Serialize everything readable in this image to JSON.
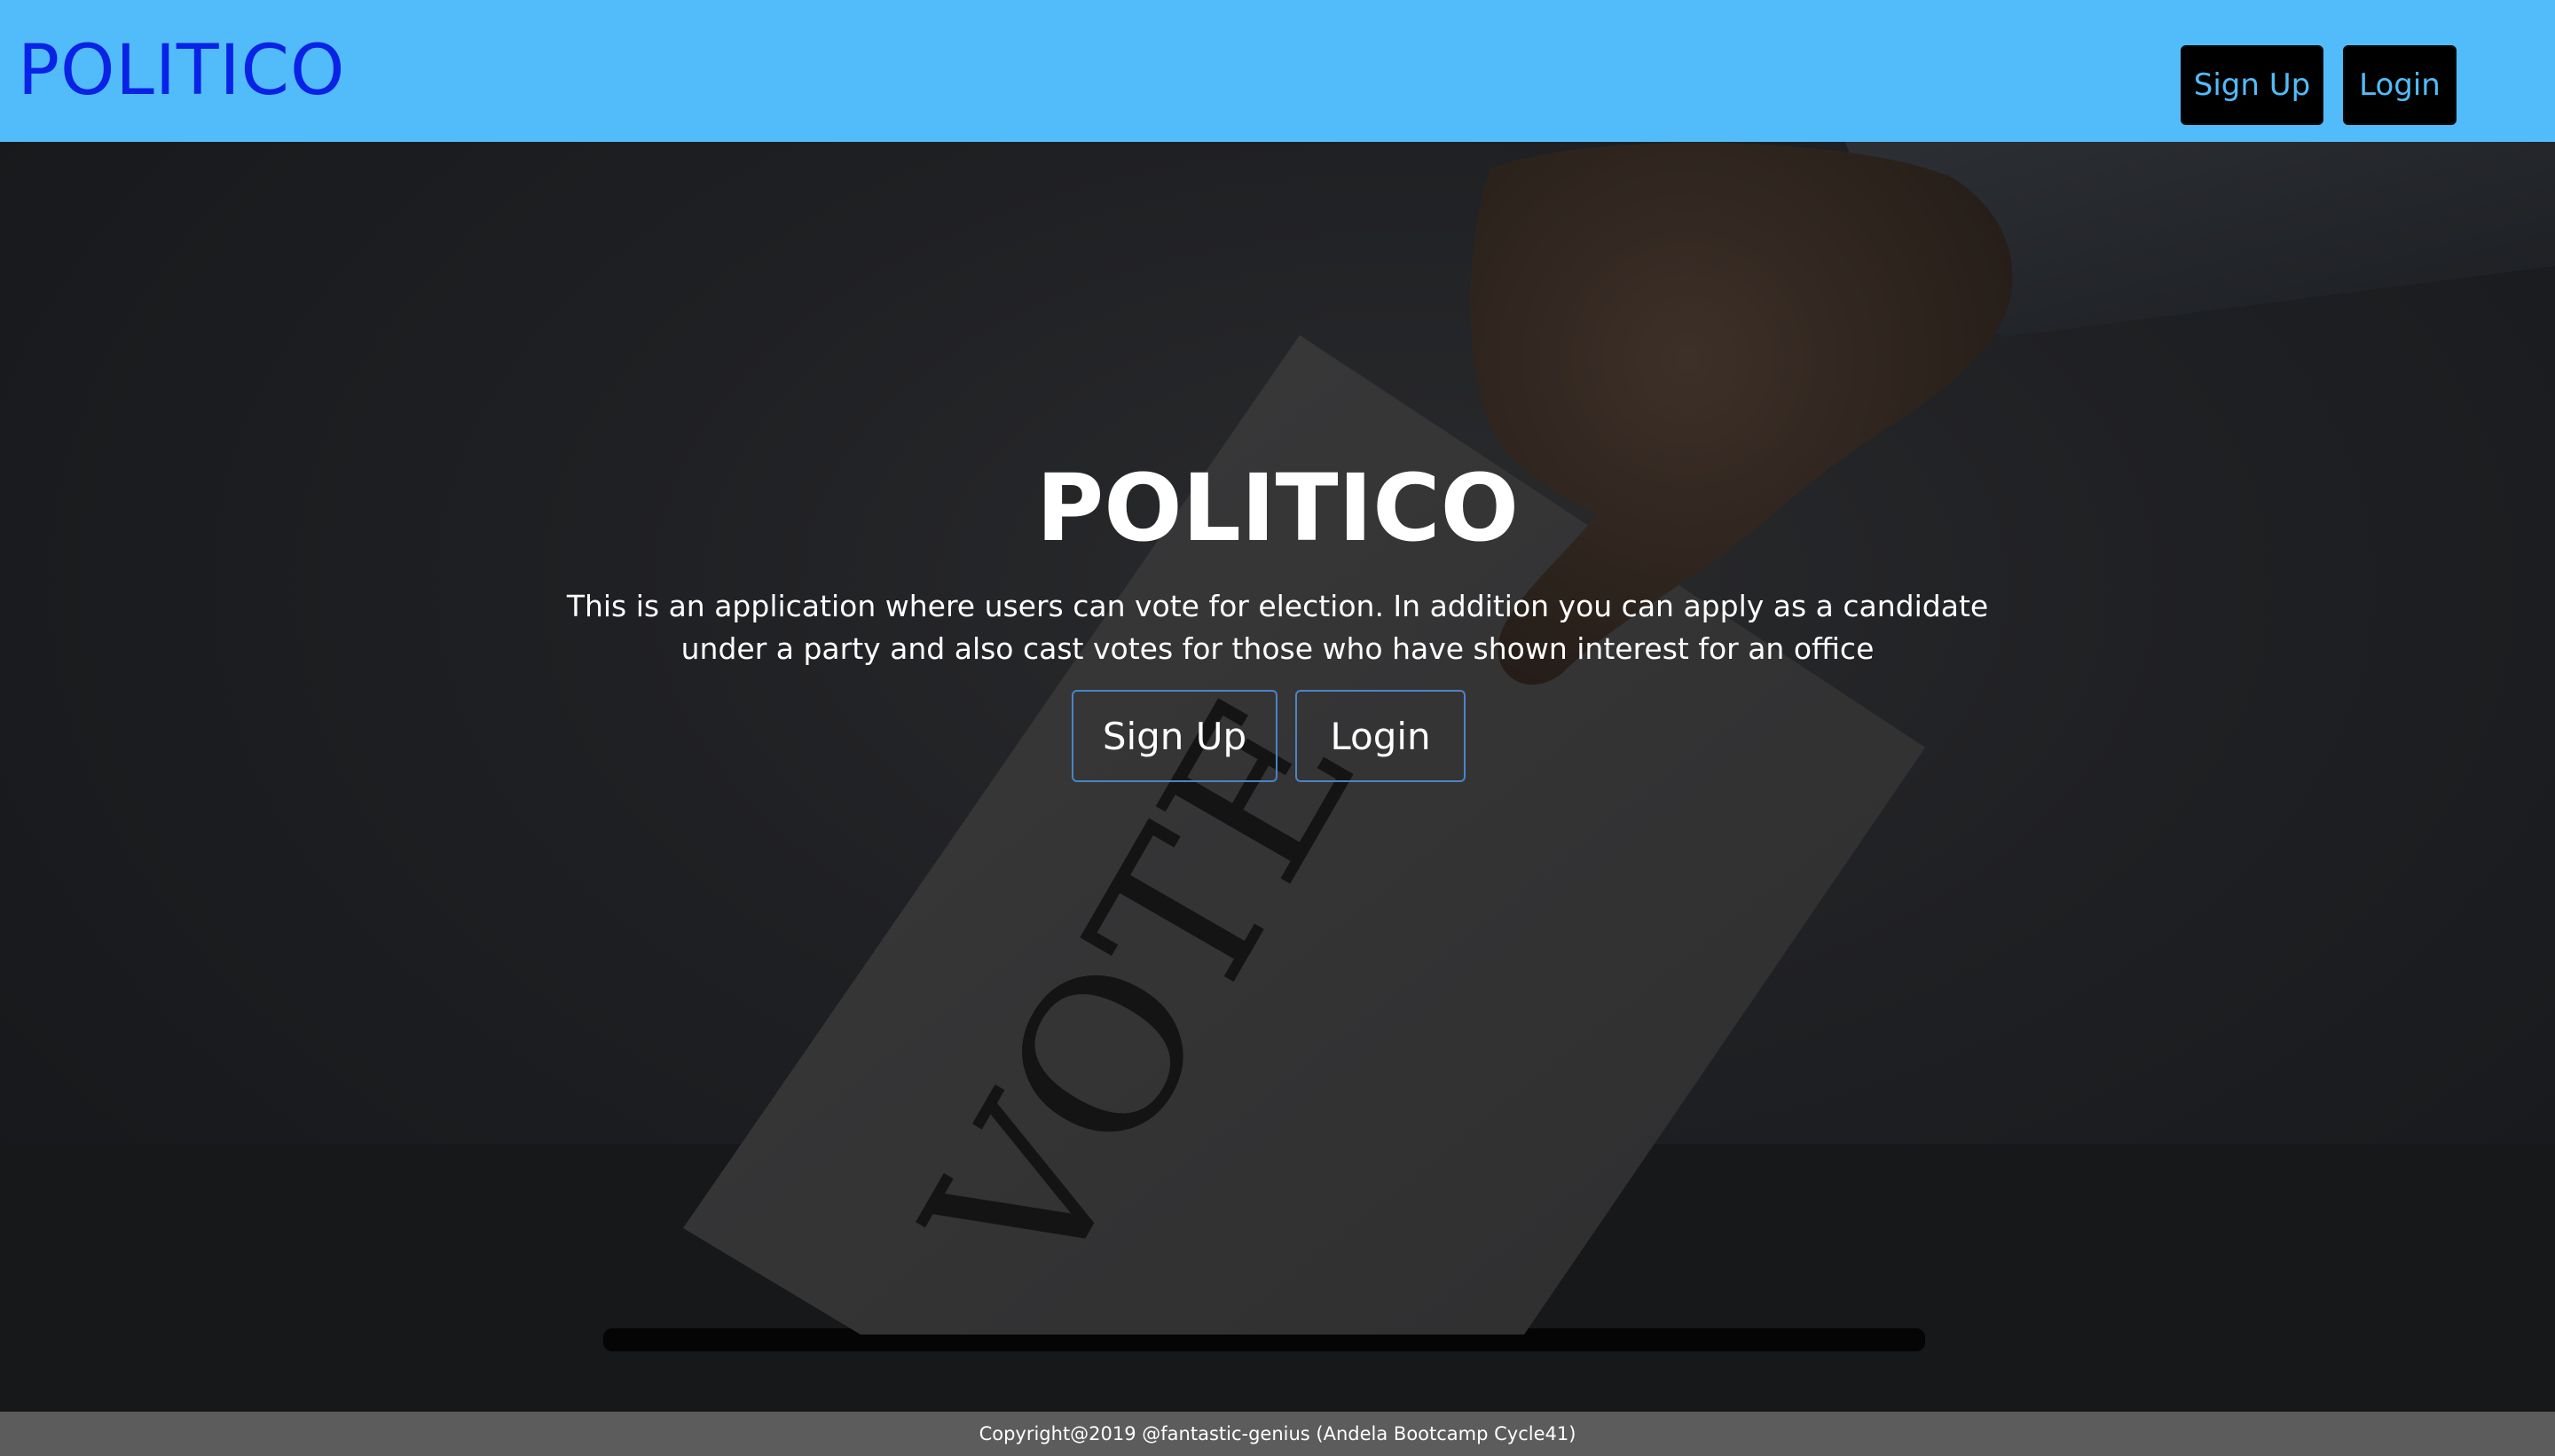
{
  "header": {
    "brand": "POLITICO",
    "signup_label": "Sign Up",
    "login_label": "Login"
  },
  "hero": {
    "title": "POLITICO",
    "description": "This is an application where users can vote for election. In addition you can apply as a candidate under a party and also cast votes for those who have shown interest for an office",
    "signup_label": "Sign Up",
    "login_label": "Login",
    "background_image": "ballot-vote-photo",
    "ballot_text": "VOTE"
  },
  "footer": {
    "text": "Copyright@2019 @fantastic-genius (Andela Bootcamp Cycle41)"
  },
  "colors": {
    "topbar": "#51bcf9",
    "brand": "#0a22e6",
    "nav_button_bg": "#000000",
    "nav_button_text": "#51bcf9",
    "hero_button_border": "#4a84c4",
    "footer_bg": "#5c5c5c"
  }
}
